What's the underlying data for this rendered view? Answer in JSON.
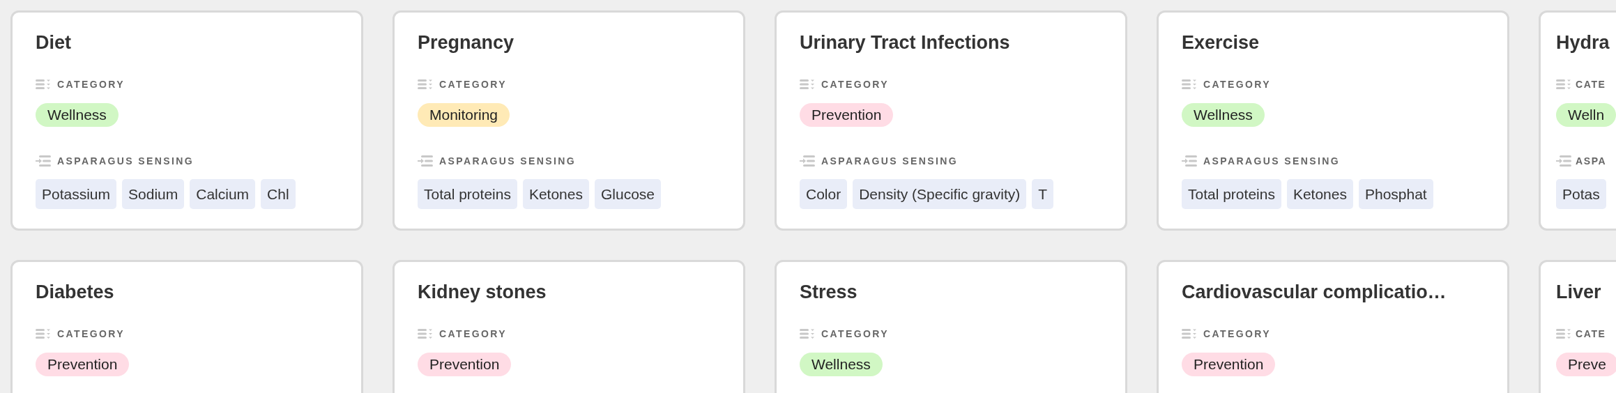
{
  "cards": [
    {
      "title": "Diet",
      "category_heading": "CATEGORY",
      "category": {
        "label": "Wellness",
        "color": "#d1f7c4"
      },
      "sensing": {
        "heading": "ASPARAGUS SENSING",
        "tags": [
          "Potassium",
          "Sodium",
          "Calcium",
          "Chl"
        ]
      }
    },
    {
      "title": "Pregnancy",
      "category_heading": "CATEGORY",
      "category": {
        "label": "Monitoring",
        "color": "#ffeab6"
      },
      "sensing": {
        "heading": "ASPARAGUS SENSING",
        "tags": [
          "Total proteins",
          "Ketones",
          "Glucose"
        ]
      }
    },
    {
      "title": "Urinary Tract Infections",
      "category_heading": "CATEGORY",
      "category": {
        "label": "Prevention",
        "color": "#ffdce5"
      },
      "sensing": {
        "heading": "ASPARAGUS SENSING",
        "tags": [
          "Color",
          "Density (Specific gravity)",
          "T"
        ]
      }
    },
    {
      "title": "Exercise",
      "category_heading": "CATEGORY",
      "category": {
        "label": "Wellness",
        "color": "#d1f7c4"
      },
      "sensing": {
        "heading": "ASPARAGUS SENSING",
        "tags": [
          "Total proteins",
          "Ketones",
          "Phosphat"
        ]
      }
    },
    {
      "title": "Hydra",
      "category_heading": "CATE",
      "category": {
        "label": "Welln",
        "color": "#d1f7c4"
      },
      "sensing": {
        "heading": "ASPA",
        "tags": [
          "Potas"
        ]
      }
    },
    {
      "title": "Diabetes",
      "category_heading": "CATEGORY",
      "category": {
        "label": "Prevention",
        "color": "#ffdce5"
      }
    },
    {
      "title": "Kidney stones",
      "category_heading": "CATEGORY",
      "category": {
        "label": "Prevention",
        "color": "#ffdce5"
      }
    },
    {
      "title": "Stress",
      "category_heading": "CATEGORY",
      "category": {
        "label": "Wellness",
        "color": "#d1f7c4"
      }
    },
    {
      "title": "Cardiovascular complicatio…",
      "category_heading": "CATEGORY",
      "category": {
        "label": "Prevention",
        "color": "#ffdce5"
      }
    },
    {
      "title": "Liver",
      "category_heading": "CATE",
      "category": {
        "label": "Preve",
        "color": "#ffdce5"
      }
    }
  ]
}
